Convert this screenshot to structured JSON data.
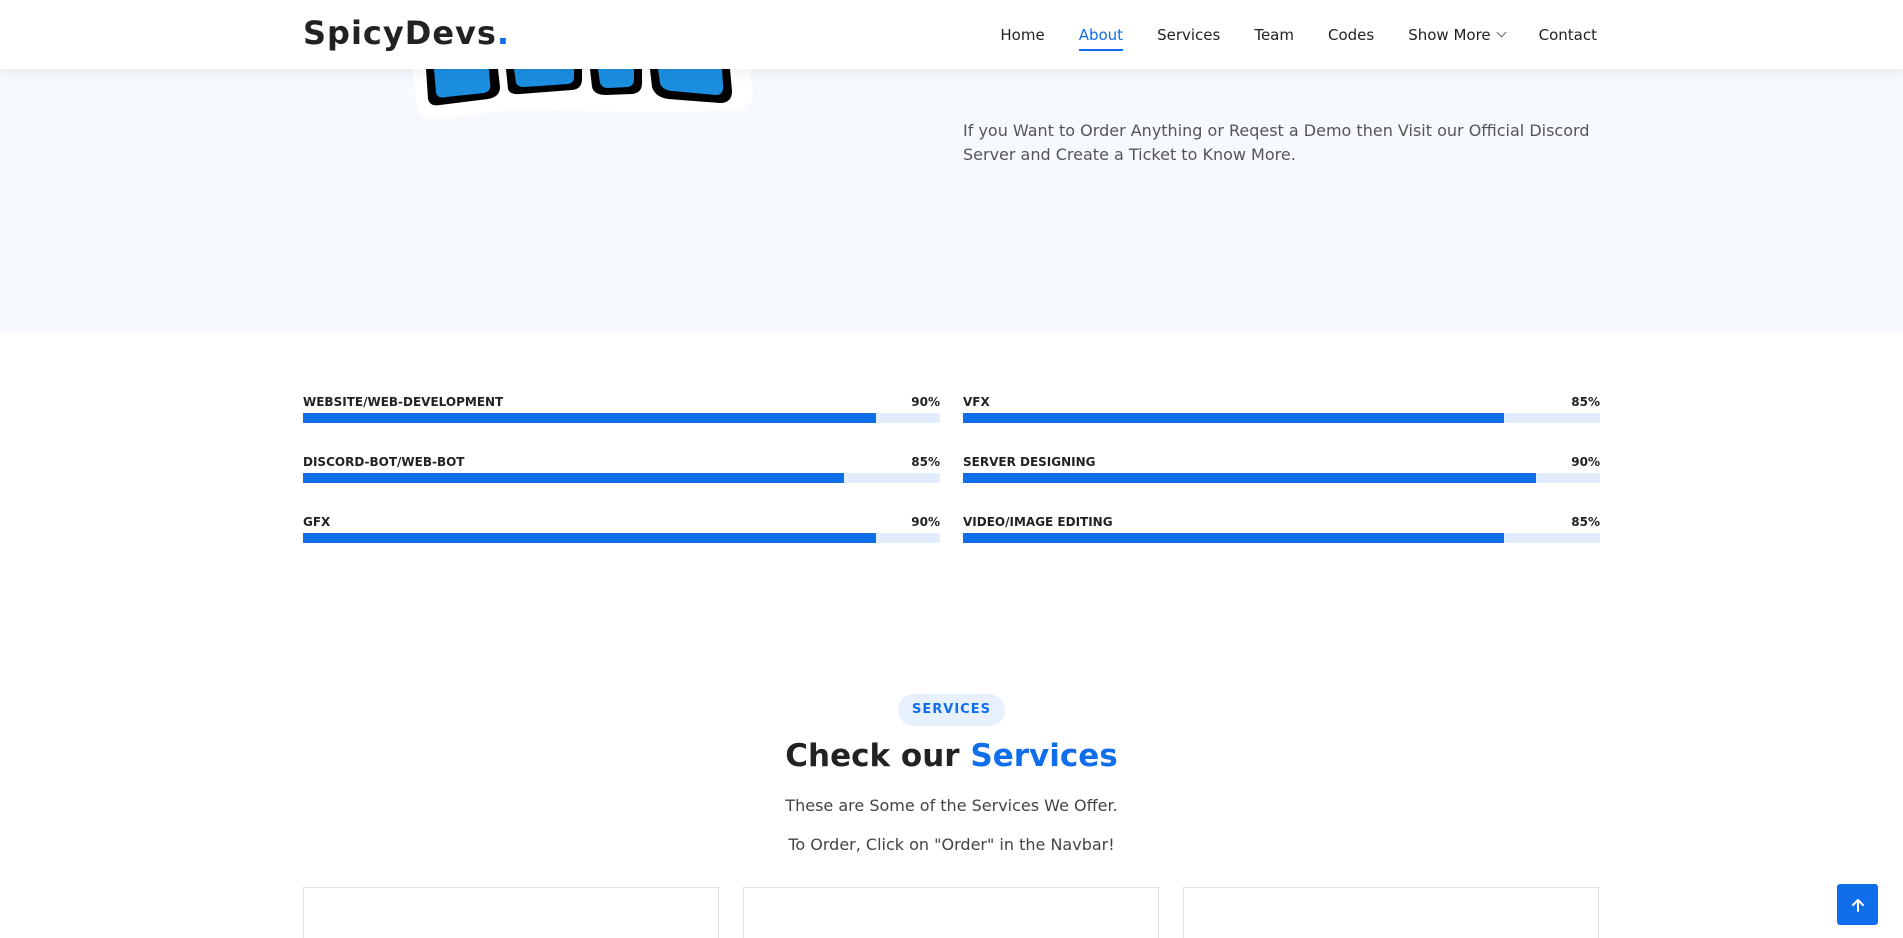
{
  "header": {
    "logo_text": "SpicyDevs",
    "logo_dot": ".",
    "nav": [
      {
        "label": "Home",
        "active": false
      },
      {
        "label": "About",
        "active": true
      },
      {
        "label": "Services",
        "active": false
      },
      {
        "label": "Team",
        "active": false
      },
      {
        "label": "Codes",
        "active": false
      },
      {
        "label": "Show More",
        "active": false,
        "dropdown": true
      },
      {
        "label": "Contact",
        "active": false
      }
    ]
  },
  "about": {
    "paragraph": "If you Want to Order Anything or Reqest a Demo then Visit our Official Discord Server and Create a Ticket to Know More."
  },
  "skills": [
    {
      "label": "WEBSITE/WEB-DEVELOPMENT",
      "value": "90%",
      "percent": 90
    },
    {
      "label": "VFX",
      "value": "85%",
      "percent": 85
    },
    {
      "label": "DISCORD-BOT/WEB-BOT",
      "value": "85%",
      "percent": 85
    },
    {
      "label": "SERVER DESIGNING",
      "value": "90%",
      "percent": 90
    },
    {
      "label": "GFX",
      "value": "90%",
      "percent": 90
    },
    {
      "label": "VIDEO/IMAGE EDITING",
      "value": "85%",
      "percent": 85
    }
  ],
  "services": {
    "badge": "SERVICES",
    "title_prefix": "Check our",
    "title_highlight": "Services",
    "subtitle_1": "These are Some of the Services We Offer.",
    "subtitle_2": "To Order, Click on \"Order\" in the Navbar!"
  },
  "colors": {
    "accent": "#106eea",
    "about_bg": "#f6f9fe",
    "bar_track": "#e2eefd"
  },
  "icons": {
    "back_to_top": "arrow-up-icon",
    "dropdown": "chevron-down-icon"
  }
}
